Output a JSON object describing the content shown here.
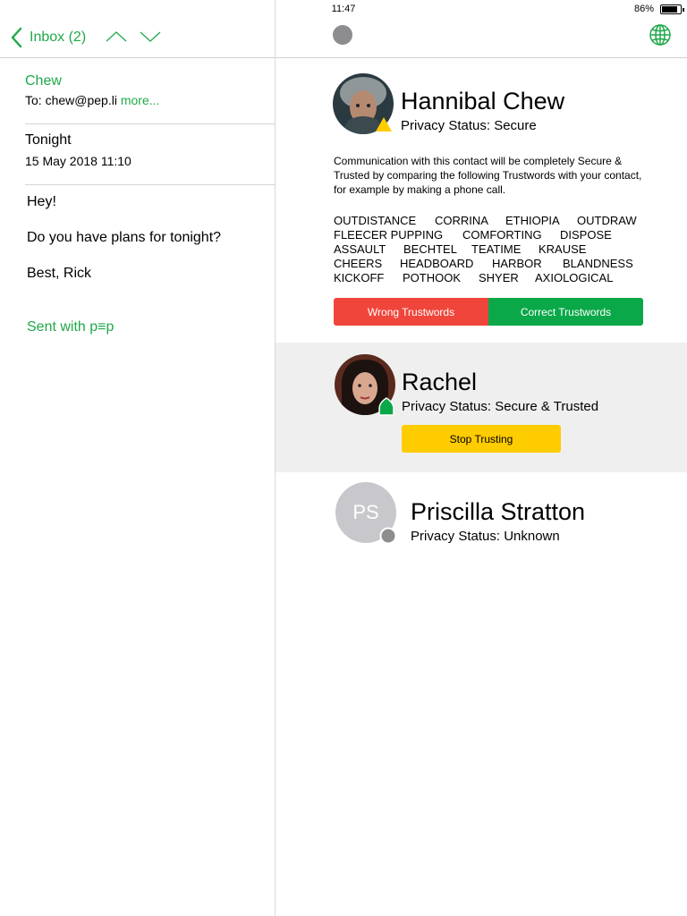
{
  "status_bar": {
    "time": "11:47",
    "battery_percent": "86%",
    "battery_level": 0.86
  },
  "mail": {
    "nav": {
      "back_label": "Inbox (2)"
    },
    "sender": "Chew",
    "to_label": "To: chew@pep.li",
    "more_label": "more...",
    "subject": "Tonight",
    "date": "15 May 2018 11:10",
    "body": [
      "Hey!",
      "Do you have plans for tonight?",
      "Best, Rick"
    ],
    "signature": "Sent with p≡p"
  },
  "privacy_panel": {
    "colors": {
      "secure": "#ffcc00",
      "trusted": "#0aa849",
      "unknown": "#8d8d8f",
      "wrong": "#f0453b",
      "accent": "#1fa84a"
    },
    "contacts": [
      {
        "name": "Hannibal Chew",
        "status": "Privacy Status: Secure",
        "badge": "yellow-warning-badge",
        "explanation": "Communication with this contact will be completely Secure & Trusted by comparing the following Trustwords with your contact, for example by making a phone call.",
        "trustwords": [
          [
            "OUTDISTANCE",
            "CORRINA",
            "ETHIOPIA",
            "OUTDRAW"
          ],
          [
            "FLEECER PUPPING",
            "COMFORTING",
            "DISPOSE"
          ],
          [
            "ASSAULT",
            "BECHTEL",
            "TEATIME",
            "KRAUSE"
          ],
          [
            "CHEERS",
            "HEADBOARD",
            "HARBOR",
            "BLANDNESS"
          ],
          [
            "KICKOFF",
            "POTHOOK",
            "SHYER",
            "AXIOLOGICAL"
          ]
        ],
        "wrong_label": "Wrong Trustwords",
        "correct_label": "Correct Trustwords"
      },
      {
        "name": "Rachel",
        "status": "Privacy Status: Secure & Trusted",
        "badge": "green-shield-badge",
        "stop_label": "Stop Trusting"
      },
      {
        "name": "Priscilla Stratton",
        "status": "Privacy Status: Unknown",
        "initials": "PS",
        "badge": "grey-dot-badge"
      }
    ]
  }
}
